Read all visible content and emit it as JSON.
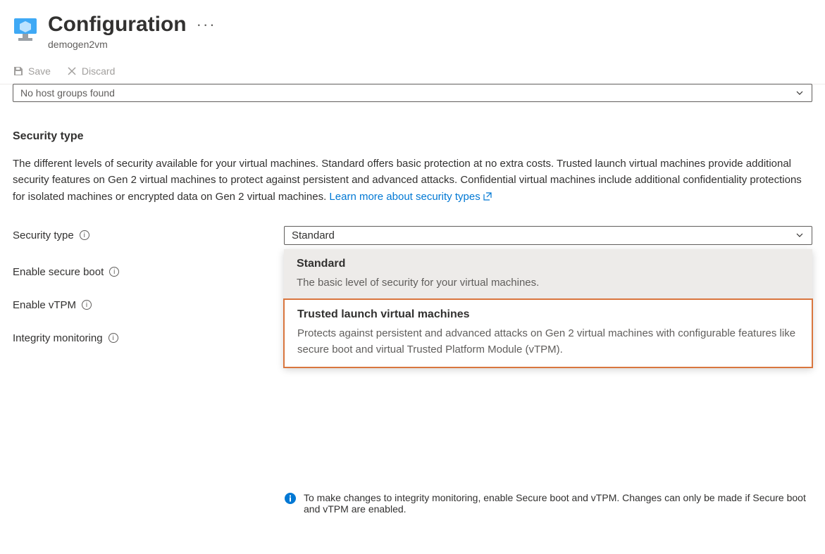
{
  "header": {
    "title": "Configuration",
    "subtitle": "demogen2vm",
    "menu_ellipsis": "···"
  },
  "toolbar": {
    "save_label": "Save",
    "discard_label": "Discard"
  },
  "hostgroup": {
    "selected": "No host groups found"
  },
  "section": {
    "title": "Security type",
    "description": "The different levels of security available for your virtual machines. Standard offers basic protection at no extra costs. Trusted launch virtual machines provide additional security features on Gen 2 virtual machines to protect against persistent and advanced attacks. Confidential virtual machines include additional confidentiality protections for isolated machines or encrypted data on Gen 2 virtual machines.",
    "learn_more": "Learn more about security types"
  },
  "fields": {
    "security_type": {
      "label": "Security type",
      "value": "Standard"
    },
    "secure_boot": {
      "label": "Enable secure boot"
    },
    "vtpm": {
      "label": "Enable vTPM"
    },
    "integrity": {
      "label": "Integrity monitoring"
    }
  },
  "dropdown": {
    "opt1_title": "Standard",
    "opt1_desc": "The basic level of security for your virtual machines.",
    "opt2_title": "Trusted launch virtual machines",
    "opt2_desc": "Protects against persistent and advanced attacks on Gen 2 virtual machines with configurable features like secure boot and virtual Trusted Platform Module (vTPM)."
  },
  "callout": {
    "text": "To make changes to integrity monitoring, enable Secure boot and vTPM. Changes can only be made if Secure boot and vTPM are enabled."
  }
}
